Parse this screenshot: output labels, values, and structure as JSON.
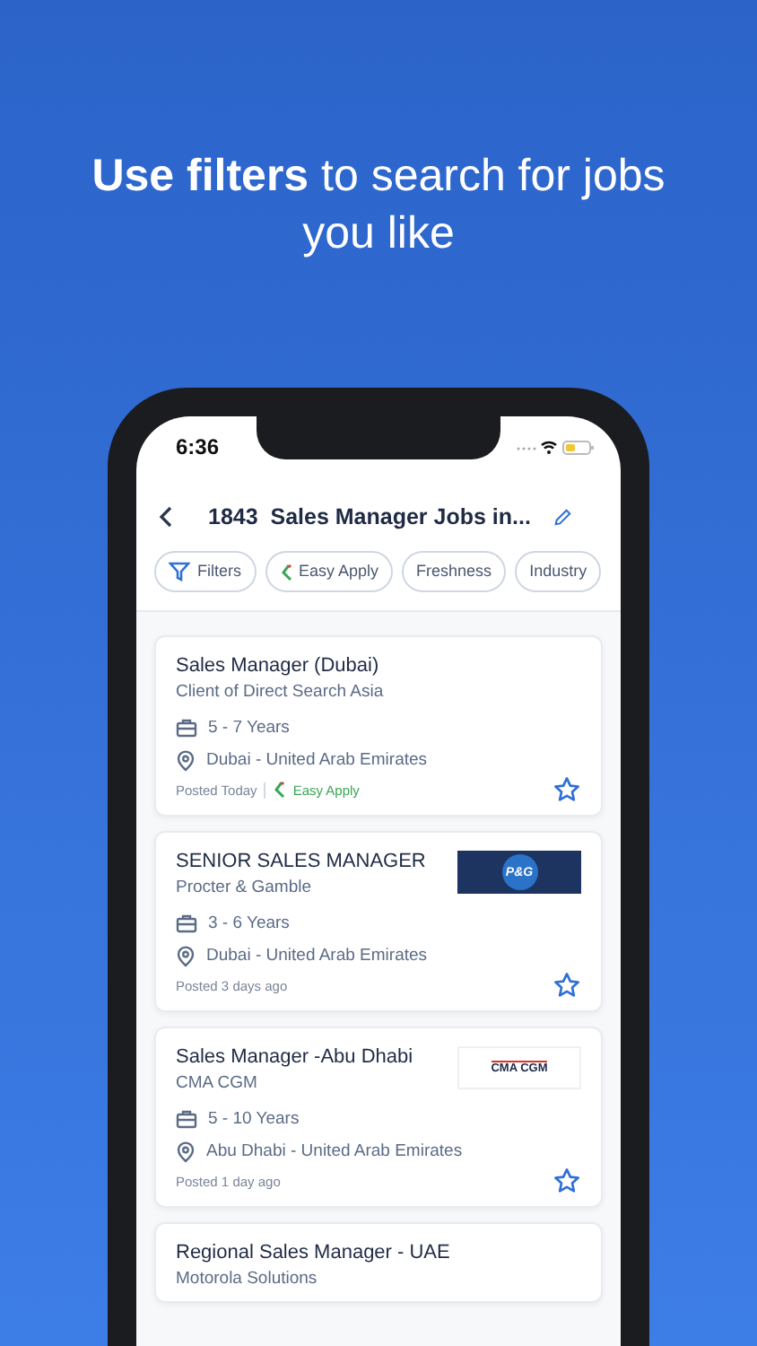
{
  "headline": "**Use filters** to search for jobs you like",
  "status_bar": {
    "time": "6:36"
  },
  "header": {
    "title": "1843  Sales Manager Jobs in..."
  },
  "filter_chips": [
    {
      "label": "Filters",
      "kind": "filter"
    },
    {
      "label": "Easy Apply",
      "kind": "easy"
    },
    {
      "label": "Freshness",
      "kind": "plain"
    },
    {
      "label": "Industry",
      "kind": "plain"
    }
  ],
  "jobs": [
    {
      "title": "Sales Manager (Dubai)",
      "company": "Client of Direct Search Asia",
      "experience": "5 - 7 Years",
      "location": "Dubai - United Arab Emirates",
      "posted": "Posted Today",
      "easy_apply": "Easy Apply",
      "saved": false
    },
    {
      "title": "SENIOR SALES MANAGER",
      "company": "Procter & Gamble",
      "experience": "3 - 6 Years",
      "location": "Dubai - United Arab Emirates",
      "posted": "Posted 3 days ago",
      "logo": {
        "kind": "dark",
        "text": "P&G"
      },
      "saved": false
    },
    {
      "title": "Sales Manager -Abu Dhabi",
      "company": "CMA CGM",
      "experience": "5 - 10 Years",
      "location": "Abu Dhabi - United Arab Emirates",
      "posted": "Posted 1 day ago",
      "logo": {
        "kind": "light",
        "text": "CMA CGM"
      },
      "saved": false
    },
    {
      "title": "Regional Sales Manager - UAE",
      "company": "Motorola Solutions"
    }
  ]
}
